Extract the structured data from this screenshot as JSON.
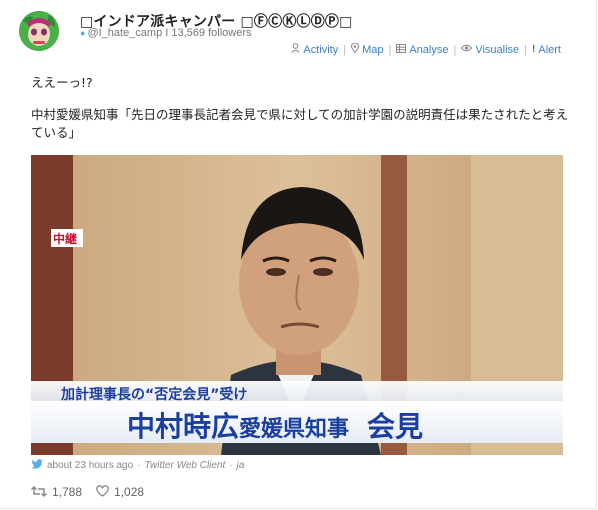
{
  "user": {
    "display_name": "□インドア派キャンパー □ⒻⒸⓀⓁⒹⓅ□",
    "handle": "@I_hate_camp",
    "followers": "13,569 followers"
  },
  "actions": [
    {
      "icon": "person-icon",
      "label": "Activity"
    },
    {
      "icon": "pin-icon",
      "label": "Map"
    },
    {
      "icon": "grid-icon",
      "label": "Analyse"
    },
    {
      "icon": "eye-icon",
      "label": "Visualise"
    },
    {
      "icon": "exclamation-icon",
      "label": "Alert"
    }
  ],
  "tweet": {
    "line1": "ええーっ!?",
    "line2": "中村愛媛県知事「先日の理事長記者会見で県に対しての加計学園の説明責任は果たされたと考えている」"
  },
  "media": {
    "badge": "中継",
    "caption_top": "加計理事長の“否定会見”受け",
    "caption_name": "中村時広",
    "caption_title": "愛媛県知事",
    "caption_event": "会見"
  },
  "meta": {
    "time": "about 23 hours ago",
    "dot1": "·",
    "client": "Twitter Web Client",
    "dot2": "·",
    "lang": "ja"
  },
  "stats": {
    "retweets": "1,788",
    "likes": "1,028"
  },
  "colors": {
    "link": "#3b7fc4",
    "caption_blue": "#1a3f9e",
    "badge_red": "#c8102e",
    "twitter_blue": "#55acee"
  }
}
